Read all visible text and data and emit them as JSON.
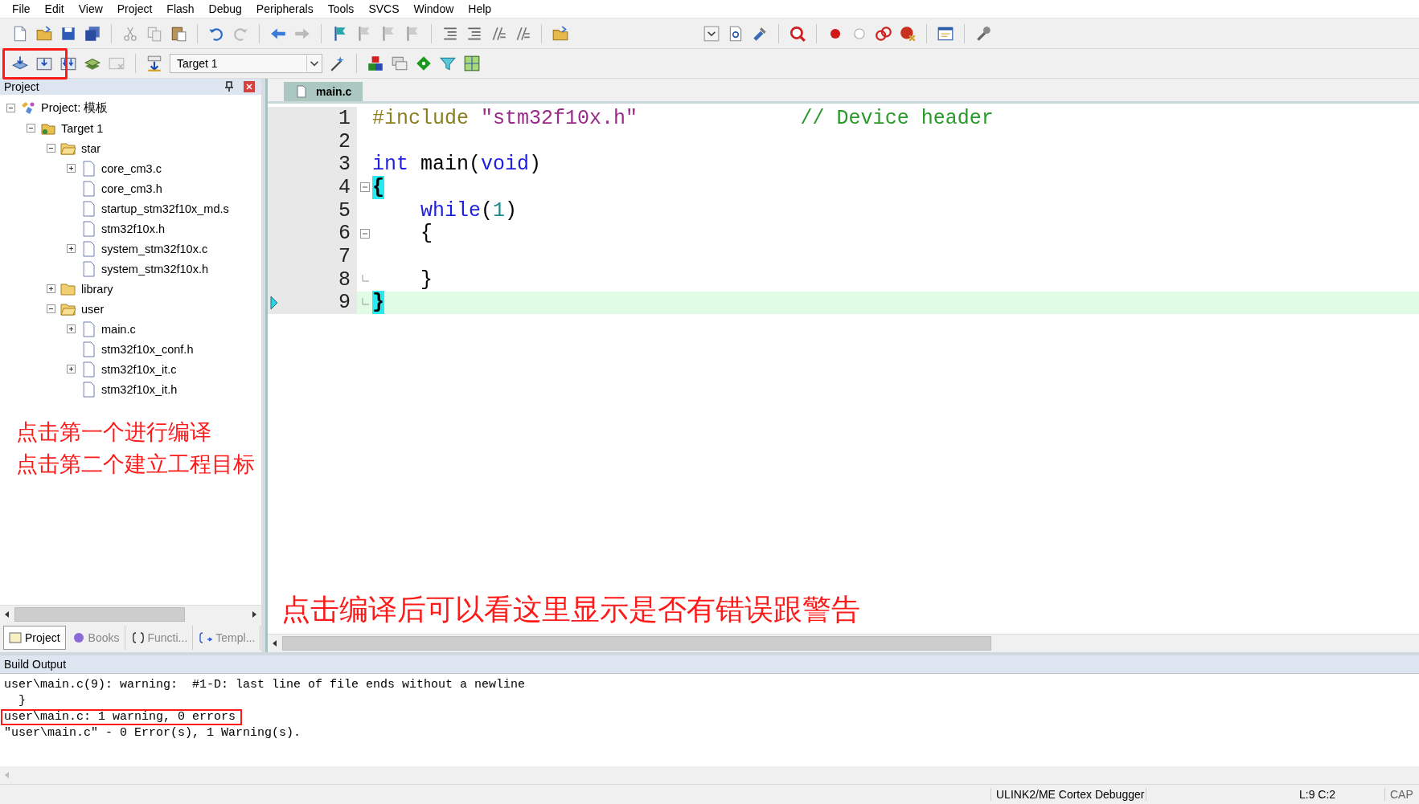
{
  "menu": [
    "File",
    "Edit",
    "View",
    "Project",
    "Flash",
    "Debug",
    "Peripherals",
    "Tools",
    "SVCS",
    "Window",
    "Help"
  ],
  "toolbar": {
    "target": "Target 1"
  },
  "project_panel": {
    "title": "Project",
    "tree": [
      {
        "label": "Project: 模板",
        "kind": "project",
        "expanded": true,
        "children": [
          {
            "label": "Target 1",
            "kind": "target",
            "expanded": true,
            "children": [
              {
                "label": "star",
                "kind": "folder",
                "expanded": true,
                "children": [
                  {
                    "label": "core_cm3.c",
                    "kind": "file",
                    "expanded": false
                  },
                  {
                    "label": "core_cm3.h",
                    "kind": "file"
                  },
                  {
                    "label": "startup_stm32f10x_md.s",
                    "kind": "file"
                  },
                  {
                    "label": "stm32f10x.h",
                    "kind": "file"
                  },
                  {
                    "label": "system_stm32f10x.c",
                    "kind": "file",
                    "expanded": false
                  },
                  {
                    "label": "system_stm32f10x.h",
                    "kind": "file"
                  }
                ]
              },
              {
                "label": "library",
                "kind": "folder",
                "expanded": false
              },
              {
                "label": "user",
                "kind": "folder",
                "expanded": true,
                "children": [
                  {
                    "label": "main.c",
                    "kind": "file",
                    "expanded": false
                  },
                  {
                    "label": "stm32f10x_conf.h",
                    "kind": "file"
                  },
                  {
                    "label": "stm32f10x_it.c",
                    "kind": "file",
                    "expanded": false
                  },
                  {
                    "label": "stm32f10x_it.h",
                    "kind": "file"
                  }
                ]
              }
            ]
          }
        ]
      }
    ],
    "tabs": [
      {
        "label": "Project",
        "selected": true
      },
      {
        "label": "Books",
        "selected": false
      },
      {
        "label": "Functi...",
        "selected": false
      },
      {
        "label": "Templ...",
        "selected": false
      }
    ]
  },
  "editor": {
    "tab": "main.c",
    "lines": [
      {
        "number": "1",
        "tokens": [
          {
            "kind": "directive",
            "text": "#include "
          },
          {
            "kind": "string",
            "text": "\"stm32f10x.h\""
          },
          {
            "kind": "comment",
            "text": "// Device header"
          }
        ]
      },
      {
        "number": "2"
      },
      {
        "number": "3",
        "tokens": [
          {
            "kind": "keyword",
            "text": "int"
          },
          {
            "kind": "plain",
            "text": " main("
          },
          {
            "kind": "keyword",
            "text": "void"
          },
          {
            "kind": "plain",
            "text": ")"
          }
        ]
      },
      {
        "number": "4",
        "fold_open": true,
        "tokens": [
          {
            "kind": "brace_match",
            "text": "{"
          }
        ]
      },
      {
        "number": "5",
        "tokens": [
          {
            "kind": "keyword",
            "text": "    while"
          },
          {
            "kind": "plain",
            "text": "("
          },
          {
            "kind": "number",
            "text": "1"
          },
          {
            "kind": "plain",
            "text": ")"
          }
        ]
      },
      {
        "number": "6",
        "fold_open": true,
        "tokens": [
          {
            "kind": "plain",
            "text": "    {"
          }
        ]
      },
      {
        "number": "7"
      },
      {
        "number": "8",
        "fold_close": true,
        "tokens": [
          {
            "kind": "plain",
            "text": "    }"
          }
        ]
      },
      {
        "number": "9",
        "fold_close": true,
        "current": true,
        "tokens": [
          {
            "kind": "brace_match",
            "text": "}"
          }
        ]
      }
    ]
  },
  "build_output": {
    "title": "Build Output",
    "lines": [
      {
        "text": "user\\main.c(9): warning:  #1-D: last line of file ends without a newline",
        "highlighted": false
      },
      {
        "text": "  }",
        "highlighted": false
      },
      {
        "text": "user\\main.c: 1 warning, 0 errors",
        "highlighted": true
      },
      {
        "text": "\"user\\main.c\" - 0 Error(s), 1 Warning(s).",
        "highlighted": false
      }
    ]
  },
  "status_bar": [
    "ULINK2/ME Cortex Debugger",
    "L:9 C:2",
    "CAP"
  ],
  "annotations": [
    "点击第一个进行编译",
    "点击第二个建立工程目标",
    "点击编译后可以看这里显示是否有错误跟警告"
  ]
}
